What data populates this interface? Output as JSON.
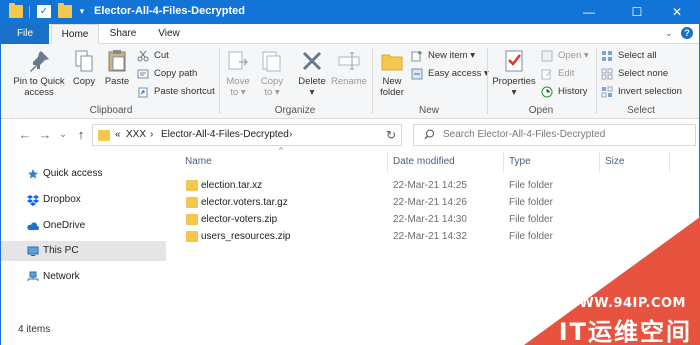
{
  "titlebar": {
    "title": "Elector-All-4-Files-Decrypted",
    "minimize": "—",
    "maximize": "☐",
    "close": "✕",
    "check": "✓",
    "dropdown": "▾"
  },
  "tabs": {
    "file": "File",
    "home": "Home",
    "share": "Share",
    "view": "View",
    "collapse": "⌄",
    "help": "?"
  },
  "ribbon": {
    "clipboard": {
      "label": "Clipboard",
      "pin_line1": "Pin to Quick",
      "pin_line2": "access",
      "copy": "Copy",
      "paste": "Paste",
      "cut": "Cut",
      "copy_path": "Copy path",
      "paste_shortcut": "Paste shortcut"
    },
    "organize": {
      "label": "Organize",
      "move_line1": "Move",
      "move_line2": "to",
      "copy_line1": "Copy",
      "copy_line2": "to",
      "delete": "Delete",
      "rename": "Rename",
      "caret": "▾"
    },
    "new": {
      "label": "New",
      "new_folder_line1": "New",
      "new_folder_line2": "folder",
      "new_item": "New item",
      "easy_access": "Easy access",
      "caret": "▾"
    },
    "open": {
      "label": "Open",
      "properties": "Properties",
      "open": "Open",
      "edit": "Edit",
      "history": "History",
      "caret": "▾"
    },
    "select": {
      "label": "Select",
      "select_all": "Select all",
      "select_none": "Select none",
      "invert_selection": "Invert selection"
    }
  },
  "navbar": {
    "back": "←",
    "forward": "→",
    "recent": "⌄",
    "up": "↑",
    "breadcrumb_prefix": "«",
    "crumb1": "XXX",
    "sep": "›",
    "crumb2": "Elector-All-4-Files-Decrypted",
    "refresh": "↻",
    "search_placeholder": "Search Elector-All-4-Files-Decrypted"
  },
  "navpane": {
    "items": [
      {
        "label": "Quick access"
      },
      {
        "label": "Dropbox"
      },
      {
        "label": "OneDrive"
      },
      {
        "label": "This PC"
      },
      {
        "label": "Network"
      }
    ]
  },
  "list": {
    "columns": {
      "name": "Name",
      "date": "Date modified",
      "type": "Type",
      "size": "Size"
    },
    "sort_indicator": "^",
    "rows": [
      {
        "name": "election.tar.xz",
        "date": "22-Mar-21 14:25",
        "type": "File folder"
      },
      {
        "name": "elector.voters.tar.gz",
        "date": "22-Mar-21 14:26",
        "type": "File folder"
      },
      {
        "name": "elector-voters.zip",
        "date": "22-Mar-21 14:30",
        "type": "File folder"
      },
      {
        "name": "users_resources.zip",
        "date": "22-Mar-21 14:32",
        "type": "File folder"
      }
    ]
  },
  "status": {
    "count": "4 items"
  },
  "watermark": {
    "url": "WWW.94IP.COM",
    "name": "IT运维空间"
  },
  "colors": {
    "titlebar": "#1174d6",
    "file_tab": "#1a6fc7",
    "folder": "#f2c94c",
    "watermark": "#e8533f"
  }
}
